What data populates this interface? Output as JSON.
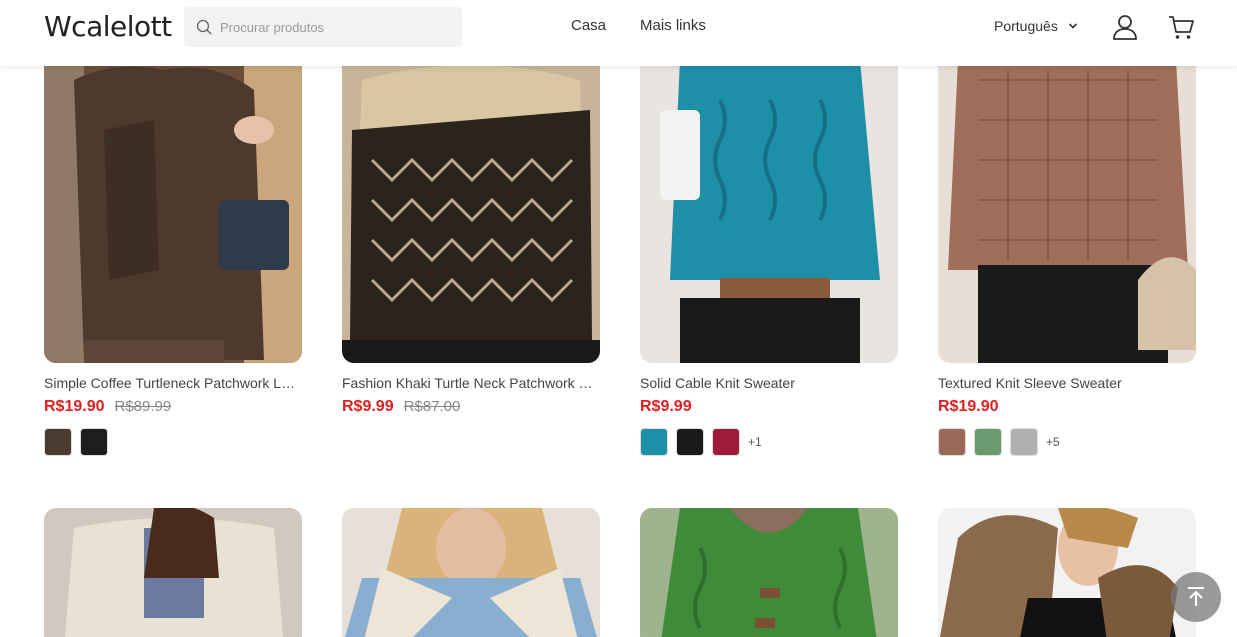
{
  "header": {
    "logo": "Wcalelott",
    "search_placeholder": "Procurar produtos",
    "nav": [
      "Casa",
      "Mais links"
    ],
    "language": "Português"
  },
  "products": [
    {
      "title": "Simple Coffee Turtleneck Patchwork Loose Sweater",
      "price": "R$19.90",
      "old_price": "R$89.99",
      "swatches": [
        "#4a3a30",
        "#1e1e1e"
      ],
      "more": ""
    },
    {
      "title": "Fashion Khaki Turtle Neck Patchwork Knitted Sweater",
      "price": "R$9.99",
      "old_price": "R$87.00",
      "swatches": [],
      "more": ""
    },
    {
      "title": "Solid Cable Knit Sweater",
      "price": "R$9.99",
      "old_price": "",
      "swatches": [
        "#1d8fa6",
        "#1a1a1a",
        "#a01b3a"
      ],
      "more": "+1"
    },
    {
      "title": "Textured Knit Sleeve Sweater",
      "price": "R$19.90",
      "old_price": "",
      "swatches": [
        "#9a6a58",
        "#6a9a6e",
        "#b0b0b0"
      ],
      "more": "+5"
    }
  ],
  "colors": {
    "price_red": "#e02020",
    "header_bg": "#ffffff"
  }
}
